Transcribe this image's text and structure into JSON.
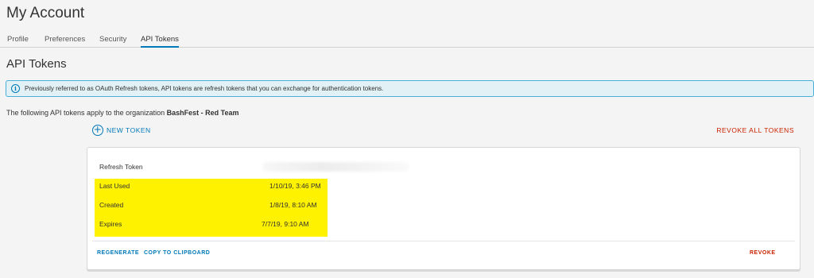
{
  "page": {
    "title": "My Account"
  },
  "tabs": [
    {
      "label": "Profile",
      "active": false
    },
    {
      "label": "Preferences",
      "active": false
    },
    {
      "label": "Security",
      "active": false
    },
    {
      "label": "API Tokens",
      "active": true
    }
  ],
  "section": {
    "title": "API Tokens"
  },
  "banner": {
    "icon": "info-icon",
    "text": "Previously referred to as OAuth Refresh tokens, API tokens are refresh tokens that you can exchange for authentication tokens."
  },
  "org": {
    "prefix": "The following API tokens apply to the organization",
    "name": "BashFest - Red Team"
  },
  "actions": {
    "new_token": "NEW TOKEN",
    "revoke_all": "REVOKE ALL TOKENS"
  },
  "token_card": {
    "refresh_token_label": "Refresh Token",
    "rows": [
      {
        "label": "Last Used",
        "value": "1/10/19, 3:46 PM"
      },
      {
        "label": "Created",
        "value": "1/8/19, 8:10 AM"
      },
      {
        "label": "Expires",
        "value": "7/7/19, 9:10 AM"
      }
    ],
    "regenerate": "REGENERATE",
    "copy": "COPY TO CLIPBOARD",
    "revoke": "REVOKE"
  },
  "colors": {
    "accent": "#0079b8",
    "danger": "#c92100",
    "highlight": "#fff200",
    "banner_bg": "#e1f1f6"
  }
}
